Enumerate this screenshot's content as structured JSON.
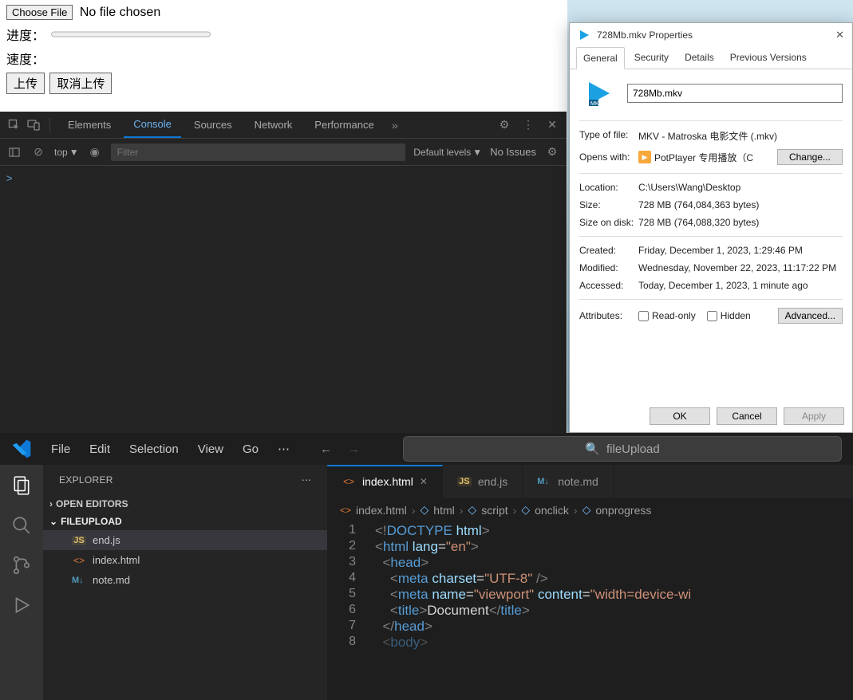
{
  "page": {
    "choose_file": "Choose File",
    "nofile": "No file chosen",
    "progress_label": "进度：",
    "speed_label": "速度：",
    "upload_btn": "上传",
    "cancel_btn": "取消上传"
  },
  "devtools": {
    "tabs": [
      "Elements",
      "Console",
      "Sources",
      "Network",
      "Performance"
    ],
    "active_tab": "Console",
    "ctx": "top",
    "filter_ph": "Filter",
    "levels": "Default levels",
    "issues": "No Issues",
    "prompt": ">"
  },
  "props": {
    "title": "728Mb.mkv Properties",
    "tabs": [
      "General",
      "Security",
      "Details",
      "Previous Versions"
    ],
    "active_tab": "General",
    "filename": "728Mb.mkv",
    "type_lbl": "Type of file:",
    "type_val": "MKV - Matroska 电影文件 (.mkv)",
    "opens_lbl": "Opens with:",
    "opens_val": "PotPlayer 专用播放（C",
    "change_btn": "Change...",
    "loc_lbl": "Location:",
    "loc_val": "C:\\Users\\Wang\\Desktop",
    "size_lbl": "Size:",
    "size_val": "728 MB (764,084,363 bytes)",
    "sod_lbl": "Size on disk:",
    "sod_val": "728 MB (764,088,320 bytes)",
    "created_lbl": "Created:",
    "created_val": "Friday, December 1, 2023, 1:29:46 PM",
    "mod_lbl": "Modified:",
    "mod_val": "Wednesday, November 22, 2023, 11:17:22 PM",
    "acc_lbl": "Accessed:",
    "acc_val": "Today, December 1, 2023, 1 minute ago",
    "attr_lbl": "Attributes:",
    "readonly": "Read-only",
    "hidden": "Hidden",
    "advanced": "Advanced...",
    "ok": "OK",
    "cancel": "Cancel",
    "apply": "Apply"
  },
  "vscode": {
    "menu": [
      "File",
      "Edit",
      "Selection",
      "View",
      "Go"
    ],
    "search": "fileUpload",
    "explorer_title": "EXPLORER",
    "open_editors": "OPEN EDITORS",
    "folder": "FILEUPLOAD",
    "files": [
      {
        "icon": "JS",
        "name": "end.js",
        "sel": true
      },
      {
        "icon": "<>",
        "name": "index.html",
        "sel": false
      },
      {
        "icon": "M↓",
        "name": "note.md",
        "sel": false
      }
    ],
    "tabs": [
      {
        "icon": "<>",
        "name": "index.html",
        "active": true,
        "close": true
      },
      {
        "icon": "JS",
        "name": "end.js",
        "active": false
      },
      {
        "icon": "M↓",
        "name": "note.md",
        "active": false
      }
    ],
    "breadcrumb": [
      "index.html",
      "html",
      "script",
      "onclick",
      "onprogress"
    ],
    "code": [
      {
        "n": 1,
        "html": "<span class='tk-br'>&lt;!</span><span class='tk-pi'>DOCTYPE</span> <span class='tk-attr'>html</span><span class='tk-br'>&gt;</span>"
      },
      {
        "n": 2,
        "html": "<span class='tk-br'>&lt;</span><span class='tk-tag'>html</span> <span class='tk-attr'>lang</span><span class='tk-txt'>=</span><span class='tk-str'>\"en\"</span><span class='tk-br'>&gt;</span>"
      },
      {
        "n": 3,
        "html": "&nbsp;&nbsp;<span class='tk-br'>&lt;</span><span class='tk-tag'>head</span><span class='tk-br'>&gt;</span>"
      },
      {
        "n": 4,
        "html": "&nbsp;&nbsp;&nbsp;&nbsp;<span class='tk-br'>&lt;</span><span class='tk-tag'>meta</span> <span class='tk-attr'>charset</span><span class='tk-txt'>=</span><span class='tk-str'>\"UTF-8\"</span> <span class='tk-br'>/&gt;</span>"
      },
      {
        "n": 5,
        "html": "&nbsp;&nbsp;&nbsp;&nbsp;<span class='tk-br'>&lt;</span><span class='tk-tag'>meta</span> <span class='tk-attr'>name</span><span class='tk-txt'>=</span><span class='tk-str'>\"viewport\"</span> <span class='tk-attr'>content</span><span class='tk-txt'>=</span><span class='tk-str'>\"width=device-wi</span>"
      },
      {
        "n": 6,
        "html": "&nbsp;&nbsp;&nbsp;&nbsp;<span class='tk-br'>&lt;</span><span class='tk-tag'>title</span><span class='tk-br'>&gt;</span><span class='tk-txt'>Document</span><span class='tk-br'>&lt;/</span><span class='tk-tag'>title</span><span class='tk-br'>&gt;</span>"
      },
      {
        "n": 7,
        "html": "&nbsp;&nbsp;<span class='tk-br'>&lt;/</span><span class='tk-tag'>head</span><span class='tk-br'>&gt;</span>"
      },
      {
        "n": 8,
        "html": "&nbsp;&nbsp;<span class='tk-br' style='opacity:.5'>&lt;</span><span class='tk-tag' style='opacity:.5'>body</span><span class='tk-br' style='opacity:.5'>&gt;</span>"
      }
    ]
  }
}
